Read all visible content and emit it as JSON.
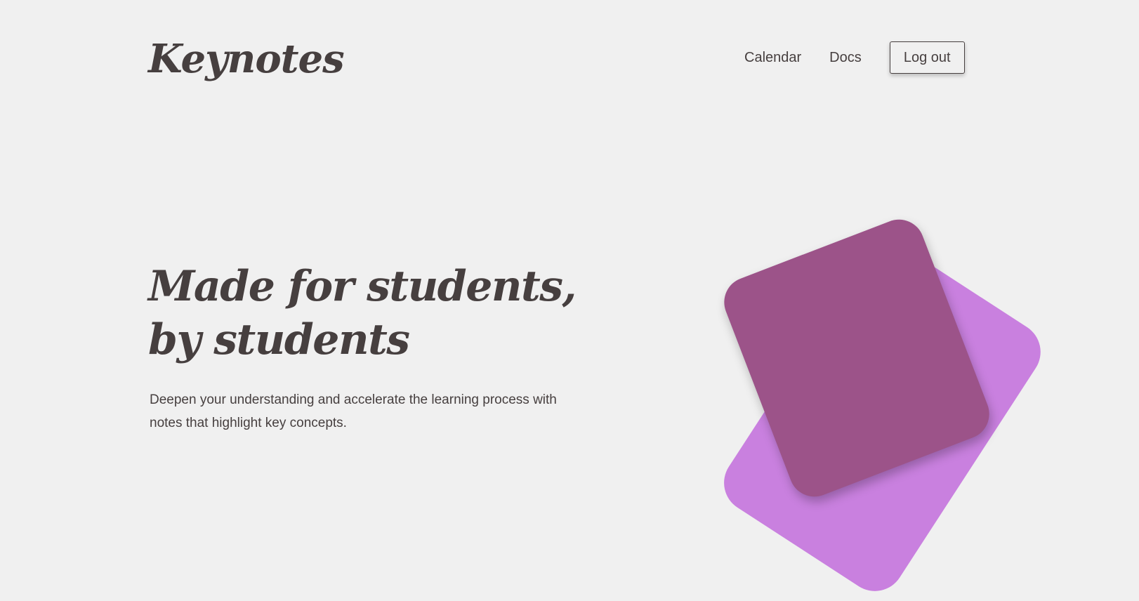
{
  "header": {
    "logo": "Keynotes",
    "nav": {
      "calendar": "Calendar",
      "docs": "Docs",
      "logout": "Log out"
    }
  },
  "hero": {
    "headline": "Made for students, by students",
    "subtext": "Deepen your understanding and accelerate the learning process with notes that highlight key concepts."
  },
  "illustration": {
    "icon": "notebook-icon",
    "colors": {
      "back": "#c980df",
      "front": "#9c5389"
    }
  },
  "theme": {
    "background": "#f0f0f0",
    "text": "#463f3f"
  }
}
